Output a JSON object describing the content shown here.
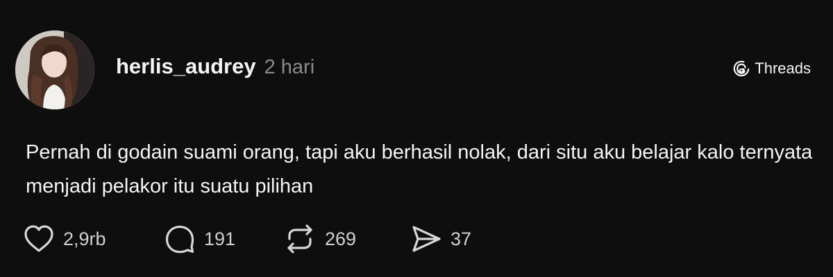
{
  "post": {
    "username": "herlis_audrey",
    "timestamp": "2 hari",
    "brand": "Threads",
    "text": "Pernah di godain suami orang, tapi aku berhasil nolak, dari situ aku belajar kalo ternyata menjadi pelakor itu suatu pilihan",
    "avatar_alt": "herlis_audrey profile photo"
  },
  "actions": {
    "likes": "2,9rb",
    "replies": "191",
    "reposts": "269",
    "shares": "37"
  },
  "icons": {
    "brand": "threads-logo-icon",
    "like": "heart-icon",
    "reply": "comment-bubble-icon",
    "repost": "repost-icon",
    "share": "send-icon"
  },
  "colors": {
    "background": "#0f0e0f",
    "primary_text": "#f3f5f7",
    "secondary_text": "#8a8b8d",
    "icon": "#d6d7d9"
  }
}
